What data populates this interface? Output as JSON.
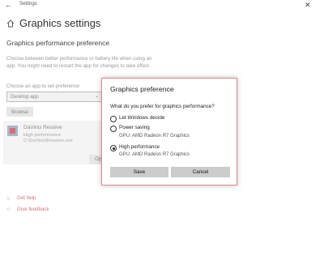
{
  "window": {
    "title": "Settings",
    "back_icon": "back-arrow-icon",
    "close_icon": "close-icon"
  },
  "page": {
    "title": "Graphics settings",
    "section_heading": "Graphics performance preference",
    "description": "Choose between better performance or battery life when using an app. You might need to restart the app for changes to take effect.",
    "choose_label": "Choose an app to set preference",
    "dropdown_value": "Desktop app",
    "browse_label": "Browse",
    "options_label": "Options"
  },
  "app_entry": {
    "name": "DaVinci Resolve",
    "preference": "High performance",
    "path": "C:\\DaVinci\\Resolve.exe"
  },
  "links": {
    "help": "Get help",
    "feedback": "Give feedback"
  },
  "dialog": {
    "title": "Graphics preference",
    "question": "What do you prefer for graphics performance?",
    "options": [
      {
        "label": "Let Windows decide",
        "sub": "",
        "checked": false
      },
      {
        "label": "Power saving",
        "sub": "GPU: AMD Radeon R7 Graphics",
        "checked": false
      },
      {
        "label": "High performance",
        "sub": "GPU: AMD Radeon R7 Graphics",
        "checked": true
      }
    ],
    "save_label": "Save",
    "cancel_label": "Cancel"
  },
  "colors": {
    "accent": "#d1747e",
    "dialog_border": "#d98a94"
  }
}
